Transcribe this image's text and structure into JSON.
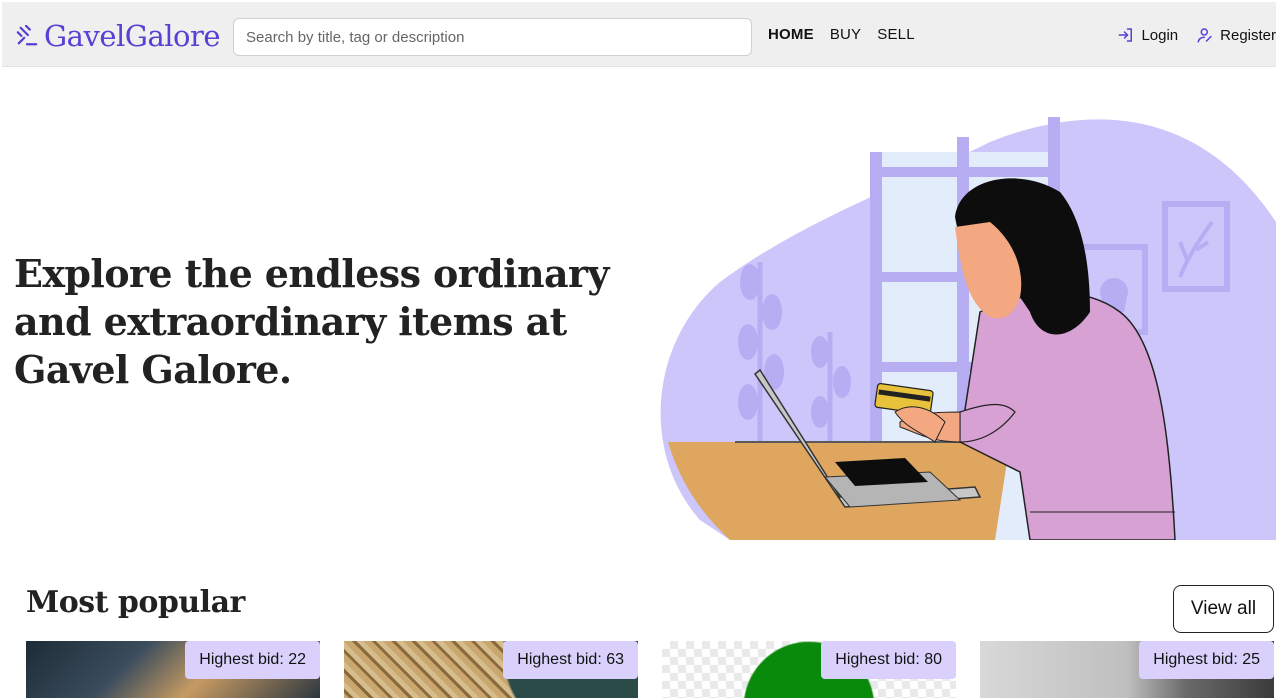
{
  "header": {
    "brand": "GavelGalore",
    "search_placeholder": "Search by title, tag or description",
    "nav": [
      "HOME",
      "BUY",
      "SELL"
    ],
    "login": "Login",
    "register": "Register"
  },
  "hero": {
    "title": "Explore the endless ordinary and extraordinary items at Gavel Galore."
  },
  "popular": {
    "title": "Most popular",
    "view_all": "View all",
    "items": [
      {
        "badge": "Highest bid: 22"
      },
      {
        "badge": "Highest bid: 63"
      },
      {
        "badge": "Highest bid: 80"
      },
      {
        "badge": "Highest bid: 25"
      }
    ]
  },
  "colors": {
    "brand": "#5a3fd4",
    "hero_blob": "#cdc6fb",
    "badge": "#d9d1fb"
  }
}
